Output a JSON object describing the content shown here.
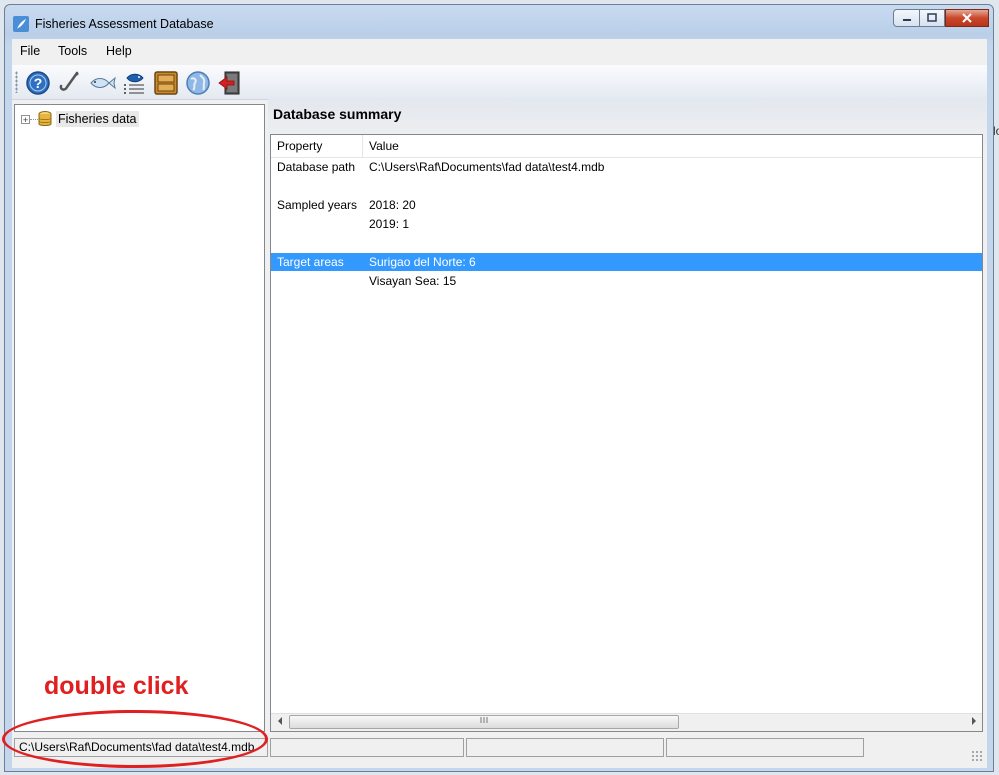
{
  "window": {
    "title": "Fisheries Assessment Database"
  },
  "menu": {
    "items": [
      "File",
      "Tools",
      "Help"
    ]
  },
  "toolbar": {
    "buttons": [
      {
        "icon": "help-icon"
      },
      {
        "icon": "hook-icon"
      },
      {
        "icon": "fish-icon"
      },
      {
        "icon": "fish-list-icon"
      },
      {
        "icon": "cabinet-icon"
      },
      {
        "icon": "globe-icon"
      },
      {
        "icon": "exit-icon"
      }
    ]
  },
  "tree": {
    "root_label": "Fisheries data",
    "expander": "+"
  },
  "summary": {
    "title": "Database summary",
    "columns": [
      "Property",
      "Value"
    ],
    "rows": [
      {
        "property": "Database path",
        "value": "C:\\Users\\Raf\\Documents\\fad data\\test4.mdb"
      },
      {
        "property": "",
        "value": ""
      },
      {
        "property": "Sampled years",
        "value": "2018: 20"
      },
      {
        "property": "",
        "value": "2019: 1"
      },
      {
        "property": "",
        "value": ""
      },
      {
        "property": "Target areas",
        "value": "Surigao del Norte: 6",
        "selected": true
      },
      {
        "property": "",
        "value": "Visayan Sea: 15"
      }
    ]
  },
  "status": {
    "path": "C:\\Users\\Raf\\Documents\\fad data\\test4.mdb"
  },
  "annotation": {
    "text": "double click",
    "color": "#e02020"
  },
  "colors": {
    "selection": "#3399ff",
    "close_button": "#c9472b"
  },
  "background": {
    "edge_text": "lo"
  }
}
